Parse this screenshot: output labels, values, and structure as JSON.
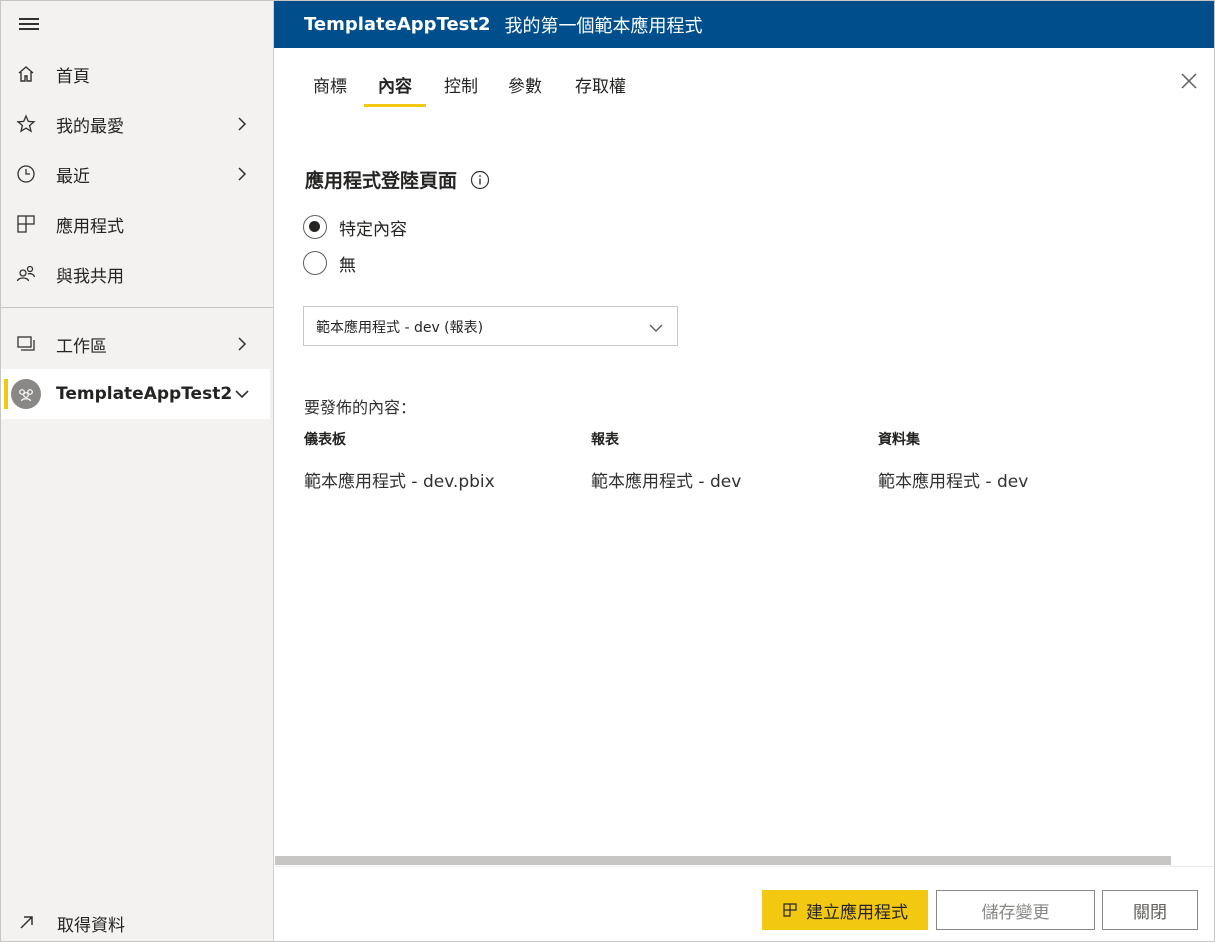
{
  "header": {
    "app_name": "TemplateAppTest2",
    "subtitle": "我的第一個範本應用程式",
    "bg_color": "#004e8c"
  },
  "sidebar": {
    "menu_icon": "hamburger-menu-icon",
    "items": [
      {
        "label": "首頁",
        "icon": "home-icon",
        "chevron": false
      },
      {
        "label": "我的最愛",
        "icon": "star-icon",
        "chevron": true
      },
      {
        "label": "最近",
        "icon": "clock-icon",
        "chevron": true
      },
      {
        "label": "應用程式",
        "icon": "apps-icon",
        "chevron": false
      },
      {
        "label": "與我共用",
        "icon": "shared-with-me-icon",
        "chevron": false
      }
    ],
    "workspaces": {
      "label": "工作區",
      "icon": "workspaces-icon",
      "chevron": true
    },
    "active_workspace": {
      "label": "TemplateAppTest2",
      "icon": "workspace-avatar-icon",
      "expanded": true
    },
    "get_data": {
      "label": "取得資料",
      "icon": "arrow-up-right-icon"
    },
    "accent_color": "#f2c811"
  },
  "tabs": [
    {
      "label": "商標",
      "selected": false
    },
    {
      "label": "內容",
      "selected": true
    },
    {
      "label": "控制",
      "selected": false
    },
    {
      "label": "參數",
      "selected": false
    },
    {
      "label": "存取權",
      "selected": false
    }
  ],
  "content": {
    "landing_title": "應用程式登陸頁面",
    "radio_options": [
      {
        "label": "特定內容",
        "checked": true
      },
      {
        "label": "無",
        "checked": false
      }
    ],
    "dropdown_value": "範本應用程式 - dev (報表)",
    "publish_label": "要發佈的內容：",
    "columns": [
      {
        "header": "儀表板",
        "value": "範本應用程式 - dev.pbix"
      },
      {
        "header": "報表",
        "value": "範本應用程式 - dev"
      },
      {
        "header": "資料集",
        "value": "範本應用程式 - dev"
      }
    ]
  },
  "footer": {
    "create_label": "建立應用程式",
    "save_label": "儲存變更",
    "close_label": "關閉"
  }
}
